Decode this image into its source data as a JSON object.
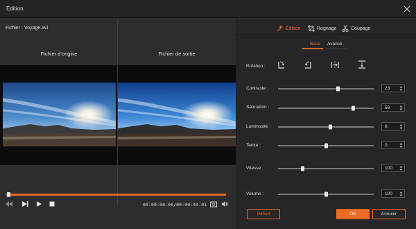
{
  "window": {
    "title": "Édition"
  },
  "file": {
    "label": "Fichier : Voyage.avi"
  },
  "preview": {
    "original_title": "Fichier d'origine",
    "output_title": "Fichier de sortie"
  },
  "player": {
    "timecode": "00:00:00.00/00:00:44.01",
    "progress_fraction": 0.01
  },
  "tool_tabs": [
    {
      "label": "Édition",
      "icon": "edit-wand-icon",
      "active": true
    },
    {
      "label": "Rognage",
      "icon": "crop-icon",
      "active": false
    },
    {
      "label": "Coupage",
      "icon": "scissors-icon",
      "active": false
    }
  ],
  "sub_tabs": [
    {
      "label": "Base",
      "active": true
    },
    {
      "label": "Avancé",
      "active": false
    }
  ],
  "rotation": {
    "label": "Rotation :",
    "buttons": [
      "rotate-clockwise-icon",
      "rotate-counterclockwise-icon",
      "flip-horizontal-icon",
      "flip-vertical-icon"
    ]
  },
  "adjustments": [
    {
      "label": "Contraste :",
      "value": "23",
      "level": 0.62
    },
    {
      "label": "Saturation :",
      "value": "56",
      "level": 0.78
    },
    {
      "label": "Luminosité :",
      "value": "8",
      "level": 0.54
    },
    {
      "label": "Teinte :",
      "value": "0",
      "level": 0.5
    },
    {
      "label": "Vitesse :",
      "value": "100",
      "level": 0.25
    },
    {
      "label": "Volume :",
      "value": "100",
      "level": 0.5
    }
  ],
  "buttons": {
    "default": "Défaut",
    "ok": "OK",
    "cancel": "Annuler"
  },
  "colors": {
    "accent": "#ef6a24",
    "panel": "#262628",
    "background": "#2b2b2d"
  }
}
